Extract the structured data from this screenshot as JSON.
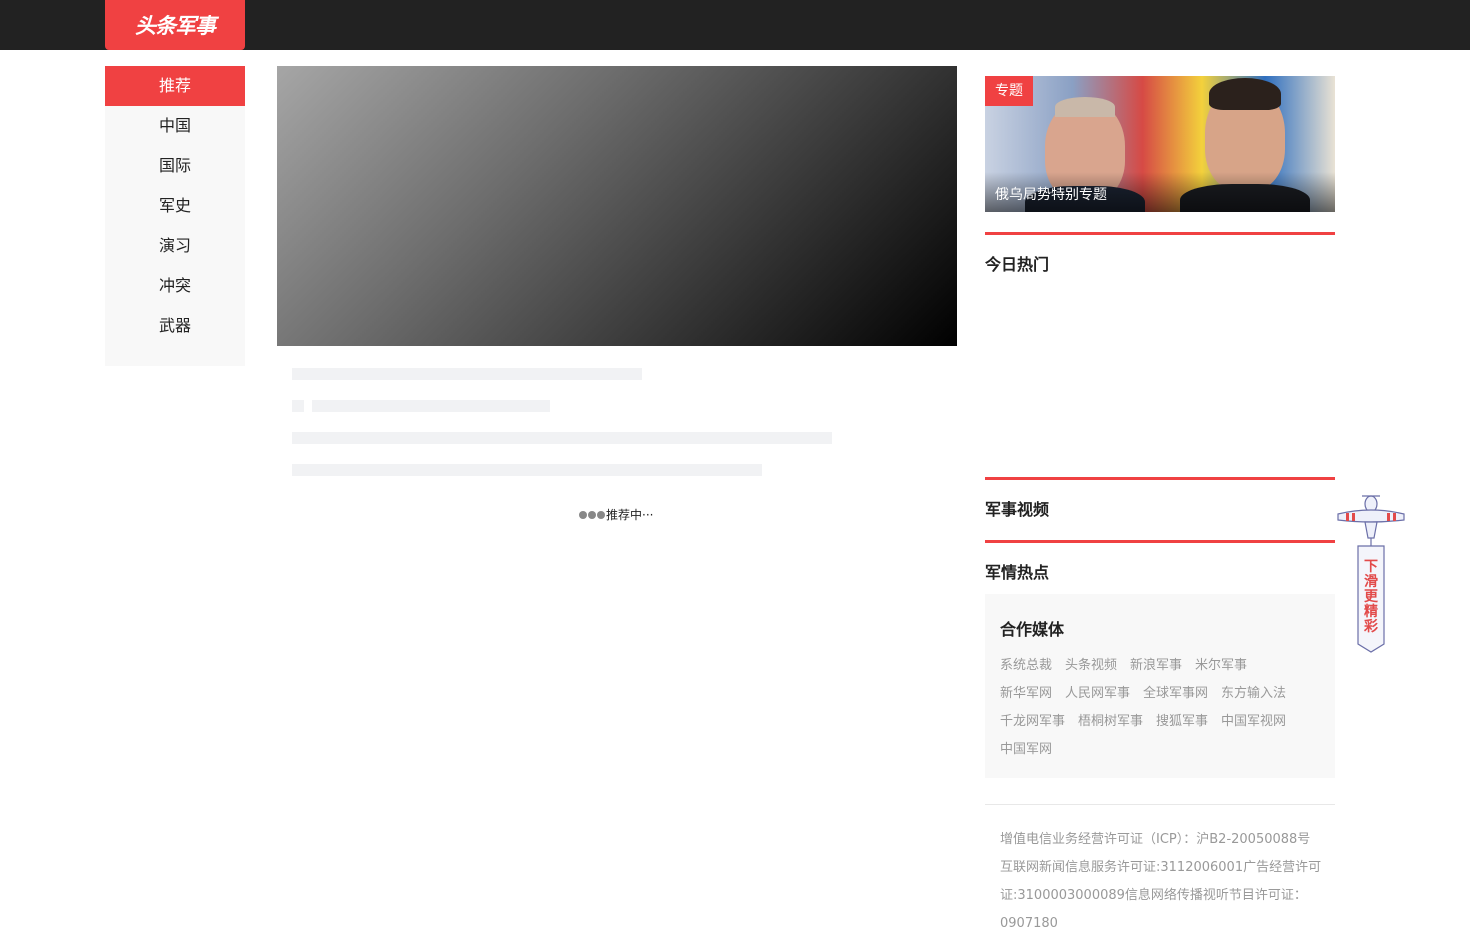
{
  "header": {
    "logo_text": "头条军事",
    "brand_color": "#f04142"
  },
  "sidebar": {
    "items": [
      {
        "label": "推荐",
        "active": true
      },
      {
        "label": "中国"
      },
      {
        "label": "国际"
      },
      {
        "label": "军史"
      },
      {
        "label": "演习"
      },
      {
        "label": "冲突"
      },
      {
        "label": "武器"
      }
    ]
  },
  "feed": {
    "loading_text": "推荐中···"
  },
  "topic": {
    "tag": "专题",
    "title": "俄乌局势特别专题"
  },
  "sections": {
    "hot_today": "今日热门",
    "military_video": "军事视频",
    "military_hot": "军情热点"
  },
  "partners": {
    "title": "合作媒体",
    "links": [
      "系统总裁",
      "头条视频",
      "新浪军事",
      "米尔军事",
      "新华军网",
      "人民网军事",
      "全球军事网",
      "东方输入法",
      "千龙网军事",
      "梧桐树军事",
      "搜狐军事",
      "中国军视网",
      "中国军网"
    ]
  },
  "footer": {
    "license_text": "增值电信业务经营许可证（ICP）：沪B2-20050088号互联网新闻信息服务许可证:3112006001广告经营许可证:3100003000089信息网络传播视听节目许可证：0907180"
  },
  "float_banner": {
    "text": "下滑更精彩",
    "icon": "airplane-icon"
  }
}
